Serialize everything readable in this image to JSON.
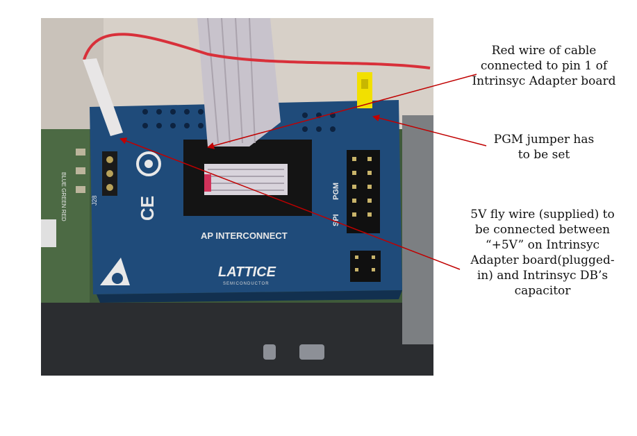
{
  "callouts": {
    "red_wire": {
      "lines": [
        "Red wire of cable",
        "connected to pin 1 of",
        "Intrinsyc Adapter board"
      ]
    },
    "pgm_jumper": {
      "lines": [
        "PGM jumper has",
        "to be set"
      ]
    },
    "fly_wire": {
      "lines": [
        "5V fly wire (supplied) to",
        "be connected between",
        "“+5V” on Intrinsyc",
        "Adapter board(plugged-",
        "in) and Intrinsyc DB’s",
        "capacitor"
      ]
    }
  },
  "board": {
    "header_label": "AP INTERCONNECT",
    "brand": "LATTICE",
    "brand_sub": "SEMICONDUCTOR",
    "spi_label": "SPI",
    "pgm_label": "PGM",
    "ce_mark": "CE",
    "jumper_label": "J28",
    "left_led_labels": "BLUE GREEN RED"
  },
  "colors": {
    "arrow": "#c00000",
    "pcb": "#1f4b7a",
    "jumper": "#f2e000",
    "wire": "#d8303a"
  }
}
